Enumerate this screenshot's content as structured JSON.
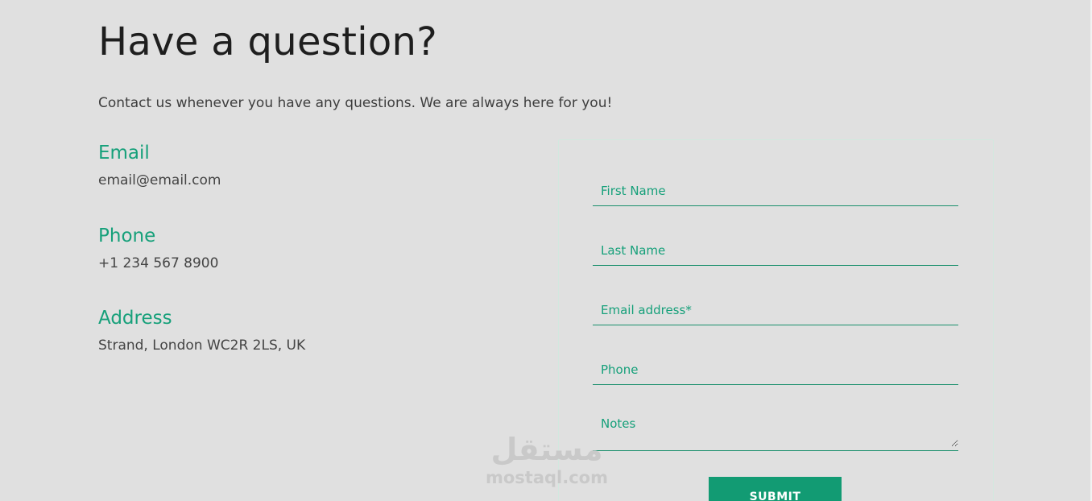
{
  "heading": "Have a question?",
  "intro": "Contact us whenever you have any questions. We are always here for you!",
  "contact": {
    "email_title": "Email",
    "email_value": "email@email.com",
    "phone_title": "Phone",
    "phone_value": "+1 234 567 8900",
    "address_title": "Address",
    "address_value": "Strand, London WC2R 2LS, UK"
  },
  "form": {
    "first_name_placeholder": "First Name",
    "last_name_placeholder": "Last Name",
    "email_placeholder": "Email address*",
    "phone_placeholder": "Phone",
    "notes_placeholder": "Notes",
    "submit_label": "SUBMIT"
  },
  "watermark": {
    "logo_text": "مستقل",
    "site_text": "mostaql.com"
  },
  "colors": {
    "background": "#e0e0e0",
    "accent": "#16a07a",
    "button": "#129b73"
  }
}
